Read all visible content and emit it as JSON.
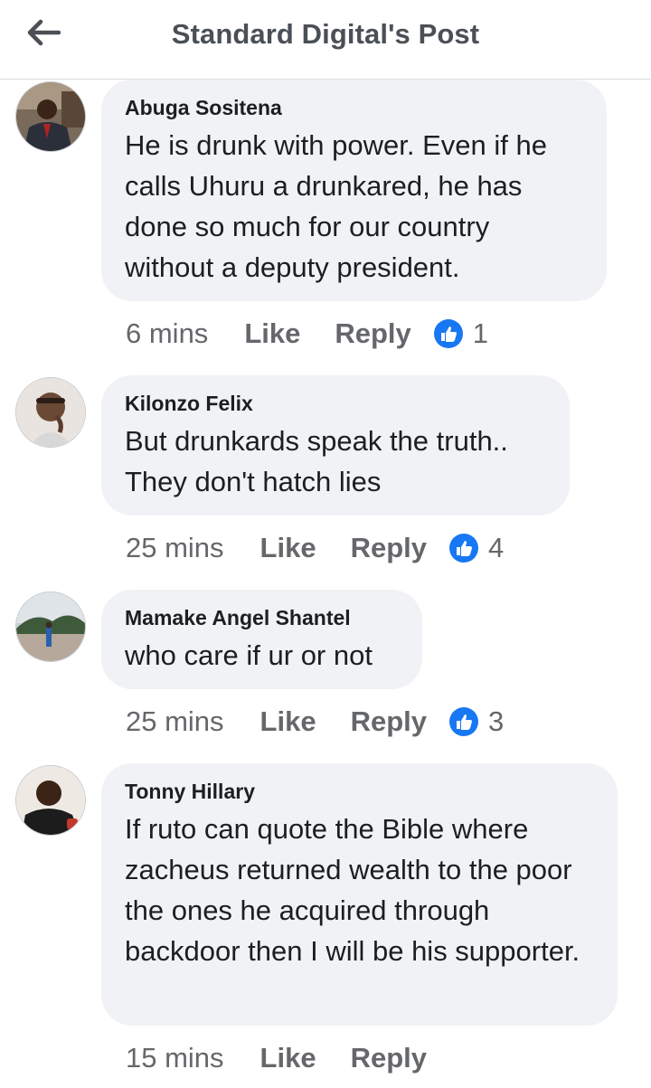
{
  "header": {
    "title": "Standard Digital's Post"
  },
  "comments": [
    {
      "author": "Abuga Sositena",
      "text": "He is drunk with power. Even if he calls Uhuru a drunkared,  he has done so much for our country without a deputy president.",
      "time": "6 mins",
      "like_label": "Like",
      "reply_label": "Reply",
      "reactions": "1"
    },
    {
      "author": "Kilonzo Felix",
      "text": "But drunkards speak the truth.. They don't hatch lies",
      "time": "25 mins",
      "like_label": "Like",
      "reply_label": "Reply",
      "reactions": "4"
    },
    {
      "author": "Mamake Angel Shantel",
      "text": "who care if ur or not",
      "time": "25 mins",
      "like_label": "Like",
      "reply_label": "Reply",
      "reactions": "3"
    },
    {
      "author": "Tonny Hillary",
      "text": "If ruto can quote the Bible where zacheus returned wealth to the poor the ones he acquired through backdoor then I will be his supporter.",
      "time": "15 mins",
      "like_label": "Like",
      "reply_label": "Reply"
    }
  ],
  "colors": {
    "like_blue": "#1877f2",
    "bubble": "#f0f2f5",
    "muted": "#65676b"
  },
  "icons": {
    "back": "arrow-left-icon",
    "reaction": "thumbs-up-icon"
  }
}
